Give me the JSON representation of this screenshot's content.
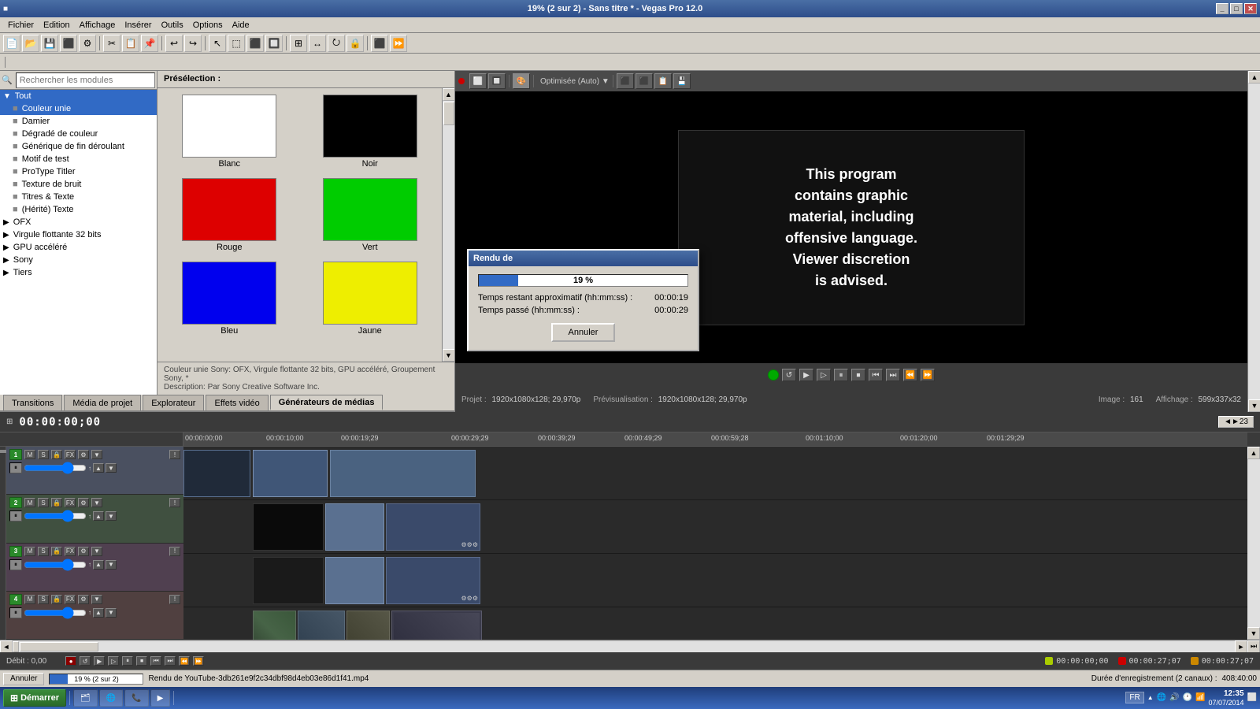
{
  "app": {
    "title": "19% (2 sur 2) - Sans titre * - Vegas Pro 12.0",
    "window_controls": [
      "_",
      "□",
      "✕"
    ]
  },
  "menu": {
    "items": [
      "Fichier",
      "Edition",
      "Affichage",
      "Insérer",
      "Outils",
      "Options",
      "Aide"
    ]
  },
  "left_panel": {
    "search_placeholder": "Rechercher les modules",
    "tree": [
      {
        "label": "Tout",
        "level": 0,
        "expanded": true,
        "icon": "▼"
      },
      {
        "label": "Couleur unie",
        "level": 1,
        "selected": true
      },
      {
        "label": "Damier",
        "level": 1
      },
      {
        "label": "Dégradé de couleur",
        "level": 1
      },
      {
        "label": "Générique de fin déroulant",
        "level": 1
      },
      {
        "label": "Motif de test",
        "level": 1
      },
      {
        "label": "ProType Titler",
        "level": 1
      },
      {
        "label": "Texture de bruit",
        "level": 1
      },
      {
        "label": "Titres & Texte",
        "level": 1
      },
      {
        "label": "(Hérité) Texte",
        "level": 1
      },
      {
        "label": "OFX",
        "level": 0,
        "icon": "▶"
      },
      {
        "label": "Virgule flottante 32 bits",
        "level": 0,
        "icon": "▶"
      },
      {
        "label": "GPU accéléré",
        "level": 0,
        "icon": "▶"
      },
      {
        "label": "Sony",
        "level": 0,
        "icon": "▶"
      },
      {
        "label": "Tiers",
        "level": 0,
        "icon": "▶"
      }
    ]
  },
  "preset_panel": {
    "header": "Présélection :",
    "items": [
      {
        "label": "Blanc",
        "color": "#ffffff"
      },
      {
        "label": "Noir",
        "color": "#000000"
      },
      {
        "label": "Rouge",
        "color": "#dd0000"
      },
      {
        "label": "Vert",
        "color": "#00cc00"
      },
      {
        "label": "Bleu",
        "color": "#0000ee"
      },
      {
        "label": "Jaune",
        "color": "#eeee00"
      }
    ],
    "description": "Couleur unie Sony: OFX, Virgule flottante 32 bits, GPU accéléré, Groupement Sony, *",
    "description2": "Description: Par Sony Creative Software Inc."
  },
  "render_dialog": {
    "title": "Rendu de",
    "progress_percent": "19 %",
    "progress_value": 19,
    "time_remaining_label": "Temps restant approximatif (hh:mm:ss) :",
    "time_remaining_value": "00:00:19",
    "time_elapsed_label": "Temps passé (hh:mm:ss) :",
    "time_elapsed_value": "00:00:29",
    "cancel_button": "Annuler"
  },
  "preview": {
    "text_line1": "This program",
    "text_line2": "contains graphic",
    "text_line3": "material, including",
    "text_line4": "offensive language.",
    "text_line5": "Viewer discretion",
    "text_line6": "is advised.",
    "quality_label": "Optimisée (Auto)",
    "info": {
      "project_label": "Projet :",
      "project_value": "1920x1080x128; 29,970p",
      "preview_label": "Prévisualisation :",
      "preview_value": "1920x1080x128; 29,970p",
      "image_label": "Image :",
      "image_value": "161",
      "display_label": "Affichage :",
      "display_value": "599x337x32"
    }
  },
  "tabs": [
    {
      "label": "Transitions",
      "active": false
    },
    {
      "label": "Média de projet",
      "active": false
    },
    {
      "label": "Explorateur",
      "active": false
    },
    {
      "label": "Effets vidéo",
      "active": false
    },
    {
      "label": "Générateurs de médias",
      "active": true
    }
  ],
  "timeline": {
    "position": "00:00:00;00",
    "timestamps": [
      "00:00:00;00",
      "00:00:10;00",
      "00:00:19;29",
      "00:00:29;29",
      "00:00:39;29",
      "00:00:49;29",
      "00:00:59;28",
      "00:01:10;00",
      "00:01:20;00",
      "00:01:29;29"
    ],
    "tracks": [
      {
        "num": "1",
        "color": "green"
      },
      {
        "num": "2",
        "color": "green"
      },
      {
        "num": "3",
        "color": "green"
      },
      {
        "num": "4",
        "color": "green"
      }
    ]
  },
  "status_bar": {
    "cancel_label": "Annuler",
    "progress_percent": "19 % (2 sur 2)",
    "render_file": "Rendu de YouTube-3db261e9f2c34dbf98d4eb03e86d1f41.mp4",
    "duration_label": "Durée d'enregistrement (2 canaux) :",
    "duration_value": "408:40:00"
  },
  "debit_bar": {
    "label": "Débit : 0,00"
  },
  "taskbar": {
    "start_label": "Démarrer",
    "apps": [
      "🗂",
      "🌐",
      "📞",
      "▶"
    ],
    "time": "12:35",
    "date": "07/07/2014",
    "lang": "FR"
  },
  "bottom_timecodes": {
    "tc1": "00:00:00;00",
    "tc2": "00:00:27;07",
    "tc3": "00:00:27;07"
  }
}
